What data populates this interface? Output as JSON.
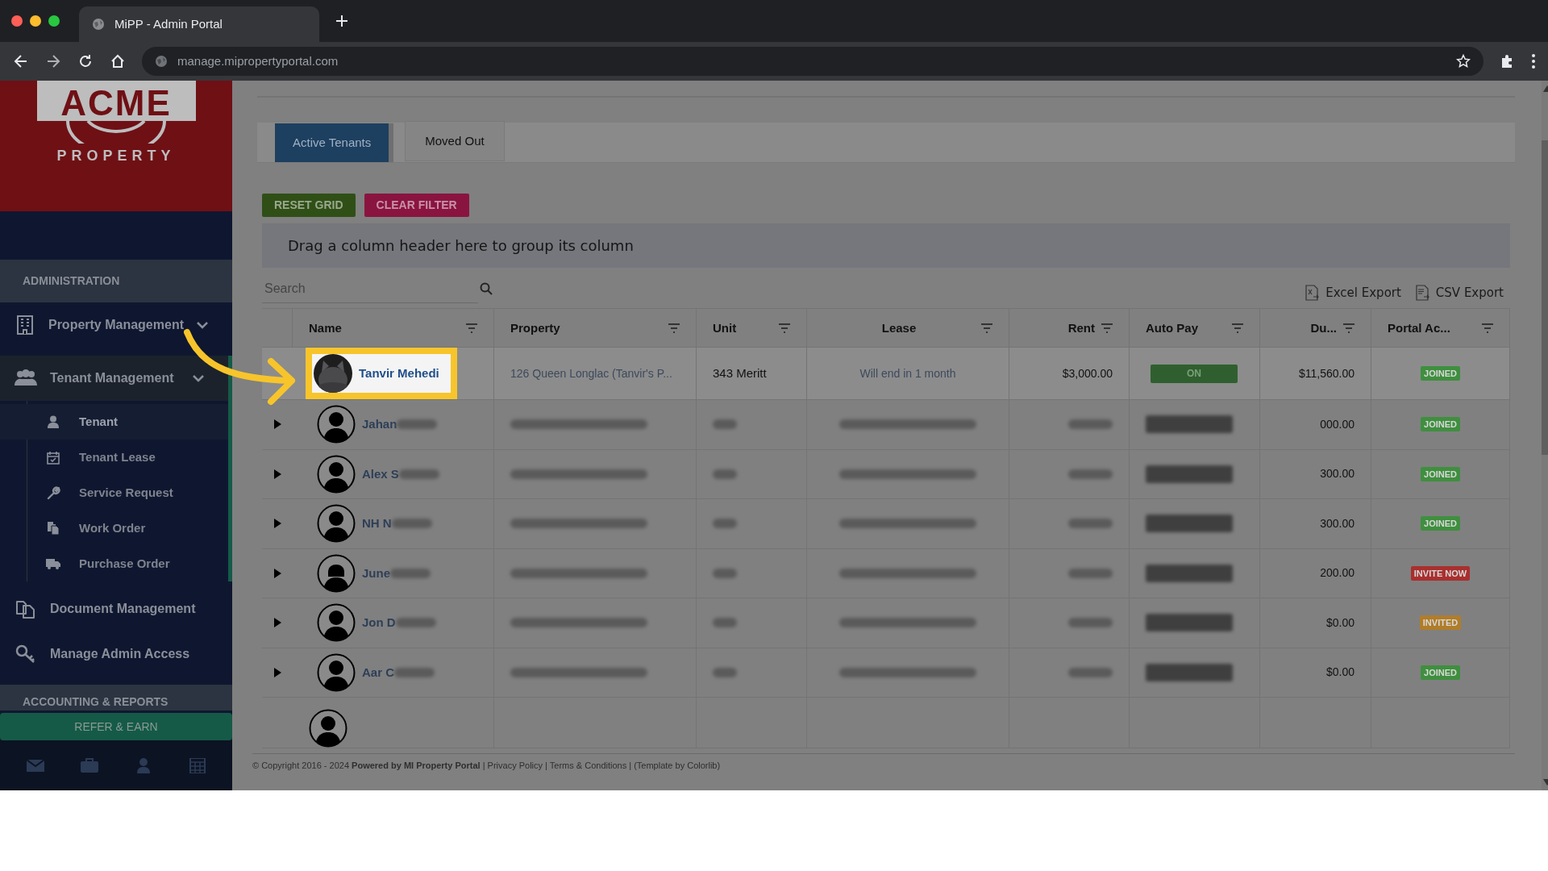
{
  "browser": {
    "tab_title": "MiPP - Admin Portal",
    "url": "manage.mipropertyportal.com"
  },
  "logo": {
    "name": "ACME",
    "tagline": "PROPERTY"
  },
  "sidebar": {
    "sections": [
      {
        "title": "ADMINISTRATION",
        "items": [
          {
            "label": "Property Management",
            "expanded": false,
            "selected": false
          },
          {
            "label": "Tenant Management",
            "expanded": true,
            "selected": true,
            "children": [
              {
                "label": "Tenant",
                "selected": true
              },
              {
                "label": "Tenant Lease",
                "selected": false
              },
              {
                "label": "Service Request",
                "selected": false
              },
              {
                "label": "Work Order",
                "selected": false
              },
              {
                "label": "Purchase Order",
                "selected": false
              }
            ]
          },
          {
            "label": "Document Management",
            "selected": false
          },
          {
            "label": "Manage Admin Access",
            "selected": false
          }
        ]
      },
      {
        "title": "ACCOUNTING & REPORTS"
      }
    ],
    "refer_button": "REFER & EARN"
  },
  "tabs": [
    {
      "label": "Active Tenants",
      "selected": true
    },
    {
      "label": "Moved Out",
      "selected": false
    }
  ],
  "buttons": [
    {
      "label": "RESET GRID",
      "kind": "reset"
    },
    {
      "label": "CLEAR FILTER",
      "kind": "clear"
    }
  ],
  "group_hint": "Drag a column header here to group its column",
  "search": {
    "placeholder": "Search"
  },
  "exports": [
    {
      "label": "Excel Export",
      "kind": "excel"
    },
    {
      "label": "CSV Export",
      "kind": "csv"
    }
  ],
  "table": {
    "columns": [
      "Name",
      "Property",
      "Unit",
      "Lease",
      "Rent",
      "Auto Pay",
      "Du...",
      "Portal Ac..."
    ],
    "rows": [
      {
        "name": "Tanvir Mehedi",
        "highlighted": true,
        "expander": false,
        "redacted": false,
        "property": "126 Queen Longlac (Tanvir's P...",
        "unit": "343 Meritt",
        "lease": "Will end in 1 month",
        "rent": "$3,000.00",
        "auto_pay": "ON",
        "due": "$11,560.00",
        "portal": {
          "label": "JOINED",
          "color": "#3f8f3f"
        }
      },
      {
        "name": "Jahan",
        "avatar": {
          "kind": "male"
        },
        "highlighted": false,
        "expander": true,
        "redacted": true,
        "due": "000.00",
        "portal": {
          "label": "JOINED",
          "color": "#3f8f3f"
        }
      },
      {
        "name": "Alex S",
        "avatar": {
          "kind": "male"
        },
        "highlighted": false,
        "expander": true,
        "redacted": true,
        "due": "300.00",
        "portal": {
          "label": "JOINED",
          "color": "#3f8f3f"
        }
      },
      {
        "name": "NH N",
        "avatar": {
          "kind": "male"
        },
        "highlighted": false,
        "expander": true,
        "redacted": true,
        "due": "300.00",
        "portal": {
          "label": "JOINED",
          "color": "#3f8f3f"
        }
      },
      {
        "name": "June",
        "avatar": {
          "kind": "female"
        },
        "highlighted": false,
        "expander": true,
        "redacted": true,
        "due": "200.00",
        "portal": {
          "label": "INVITE NOW",
          "color": "#a8302f"
        }
      },
      {
        "name": "Jon D",
        "avatar": {
          "kind": "male"
        },
        "highlighted": false,
        "expander": true,
        "redacted": true,
        "due": "$0.00",
        "portal": {
          "label": "INVITED",
          "color": "#b07d2a"
        }
      },
      {
        "name": "Aar C",
        "avatar": {
          "kind": "male"
        },
        "highlighted": false,
        "expander": true,
        "redacted": true,
        "due": "$0.00",
        "portal": {
          "label": "JOINED",
          "color": "#3f8f3f"
        }
      }
    ]
  },
  "footer": "© Copyright 2016 - 2024 **Powered by MI Property Portal** | Privacy Policy | Terms & Conditions | (Template by Colorlib)"
}
